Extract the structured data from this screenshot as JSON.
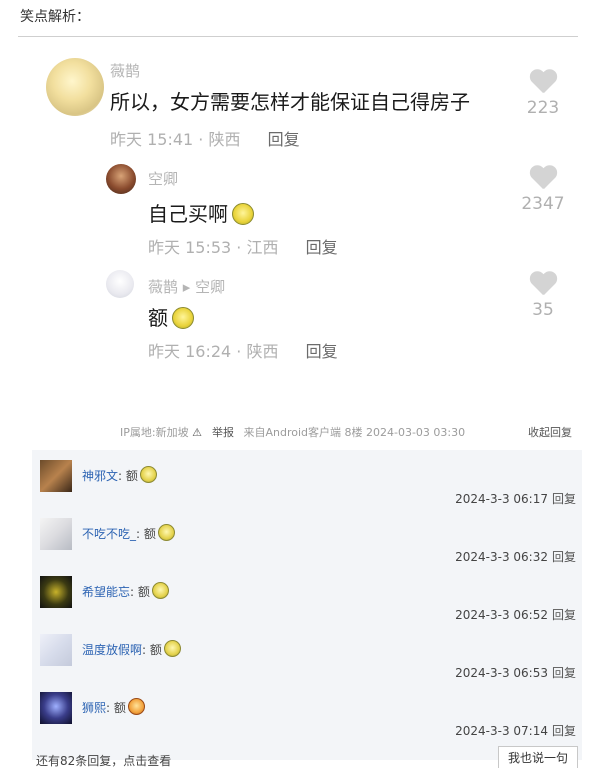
{
  "post": {
    "heading": "笑点解析："
  },
  "comments": {
    "main": {
      "user": "薇鹊",
      "text": "所以，女方需要怎样才能保证自己得房子",
      "meta": "昨天 15:41 · 陕西",
      "reply": "回复",
      "likes": "223"
    },
    "reply1": {
      "user": "空卿",
      "text": "自己买啊",
      "meta": "昨天 15:53 · 江西",
      "reply": "回复",
      "likes": "2347"
    },
    "reply2": {
      "user": "薇鹊 ▸ 空卿",
      "text": "额",
      "meta": "昨天 16:24 · 陕西",
      "reply": "回复",
      "likes": "35"
    }
  },
  "forum": {
    "ip": "IP属地:新加坡",
    "report": "举报",
    "source": "来自Android客户端",
    "floor": "8楼",
    "time": "2024-03-03 03:30",
    "collapse": "收起回复"
  },
  "replies": [
    {
      "user": "神邪文",
      "text": "额",
      "time": "2024-3-3 06:17",
      "reply": "回复",
      "emoji": "smile"
    },
    {
      "user": "不吃不吃_",
      "text": "额",
      "time": "2024-3-3 06:32",
      "reply": "回复",
      "emoji": "smile"
    },
    {
      "user": "希望能忘",
      "text": "额",
      "time": "2024-3-3 06:52",
      "reply": "回复",
      "emoji": "smile"
    },
    {
      "user": "温度放假啊",
      "text": "额",
      "time": "2024-3-3 06:53",
      "reply": "回复",
      "emoji": "smile"
    },
    {
      "user": "狮熙",
      "text": "额",
      "time": "2024-3-3 07:14",
      "reply": "回复",
      "emoji": "heart-eyes"
    }
  ],
  "footer": {
    "more": "还有82条回复，点击查看",
    "say": "我也说一句"
  },
  "colors": {
    "link": "#2d64b3",
    "reply_bg": "#f3f5f8",
    "muted": "#b0b0b0"
  }
}
